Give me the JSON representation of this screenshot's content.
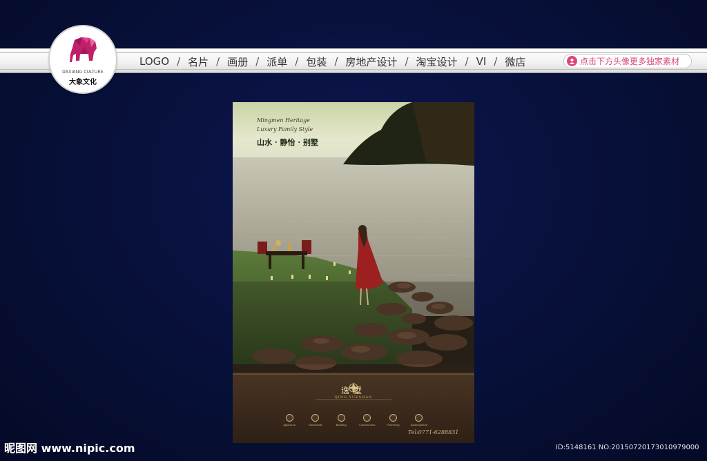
{
  "nav": {
    "items": [
      "LOGO",
      "名片",
      "画册",
      "派单",
      "包装",
      "房地产设计",
      "淘宝设计",
      "VI",
      "微店"
    ],
    "separator": "/",
    "promo_text": "点击下方头像更多独家素材",
    "promo_icon": "avatar-icon"
  },
  "logo": {
    "english": "DAXIANG CULTURE",
    "chinese": "大象文化",
    "icon": "elephant-icon",
    "color": "#c0206a"
  },
  "poster": {
    "en_line1": "Mingmen Heritage",
    "en_line2": "Luxury Family Style",
    "cn_slogan": "山水 · 静怡 · 别墅",
    "brand_cn": "逸墅",
    "brand_en": "QING YUESHAN",
    "features": [
      "Approach",
      "Household",
      "Building",
      "Construction",
      "Flowering",
      "Kindergarten"
    ],
    "tel": "Tel:0771-6288831"
  },
  "watermark": {
    "site": "昵图网 www.nipic.com",
    "id": "ID:5148161 NO:20150720173010979000"
  },
  "colors": {
    "background": "#071038",
    "gold": "#c9b27b",
    "poster_bottom": "#3b2a1c"
  }
}
